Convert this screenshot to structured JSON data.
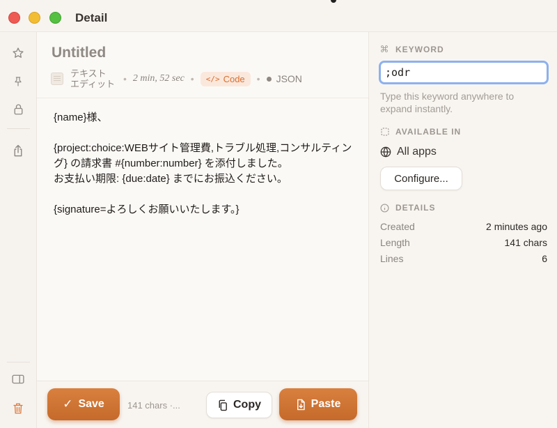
{
  "window": {
    "title": "Detail"
  },
  "rail": {
    "icons": [
      "star-icon",
      "pin-icon",
      "lock-icon",
      "share-icon",
      "sidebar-toggle-icon",
      "trash-icon"
    ]
  },
  "document": {
    "title": "Untitled",
    "app_name": "テキスト\nエディット",
    "duration": "2 min, 52 sec",
    "type_badge": "Code",
    "type_badge_icon": "</>",
    "format": "JSON",
    "body": "{name}様、\n\n{project:choice:WEBサイト管理費,トラブル処理,コンサルティング} の請求書 #{number:number} を添付しました。\nお支払い期限: {due:date} までにお振込ください。\n\n{signature=よろしくお願いいたします。}"
  },
  "bottombar": {
    "save_label": "Save",
    "chars": "141 chars ·...",
    "copy_label": "Copy",
    "paste_label": "Paste"
  },
  "inspector": {
    "keyword": {
      "heading": "KEYWORD",
      "value": ";odr",
      "hint": "Type this keyword anywhere to expand instantly."
    },
    "available": {
      "heading": "AVAILABLE IN",
      "scope": "All apps",
      "configure_label": "Configure..."
    },
    "details": {
      "heading": "DETAILS",
      "rows": [
        {
          "key": "Created",
          "value": "2 minutes ago"
        },
        {
          "key": "Length",
          "value": "141 chars"
        },
        {
          "key": "Lines",
          "value": "6"
        }
      ]
    }
  },
  "colors": {
    "accent": "#d0763a",
    "focus_ring": "#8cb1ee",
    "badge_bg": "#fbe8dc",
    "trash": "#e07a3c"
  }
}
